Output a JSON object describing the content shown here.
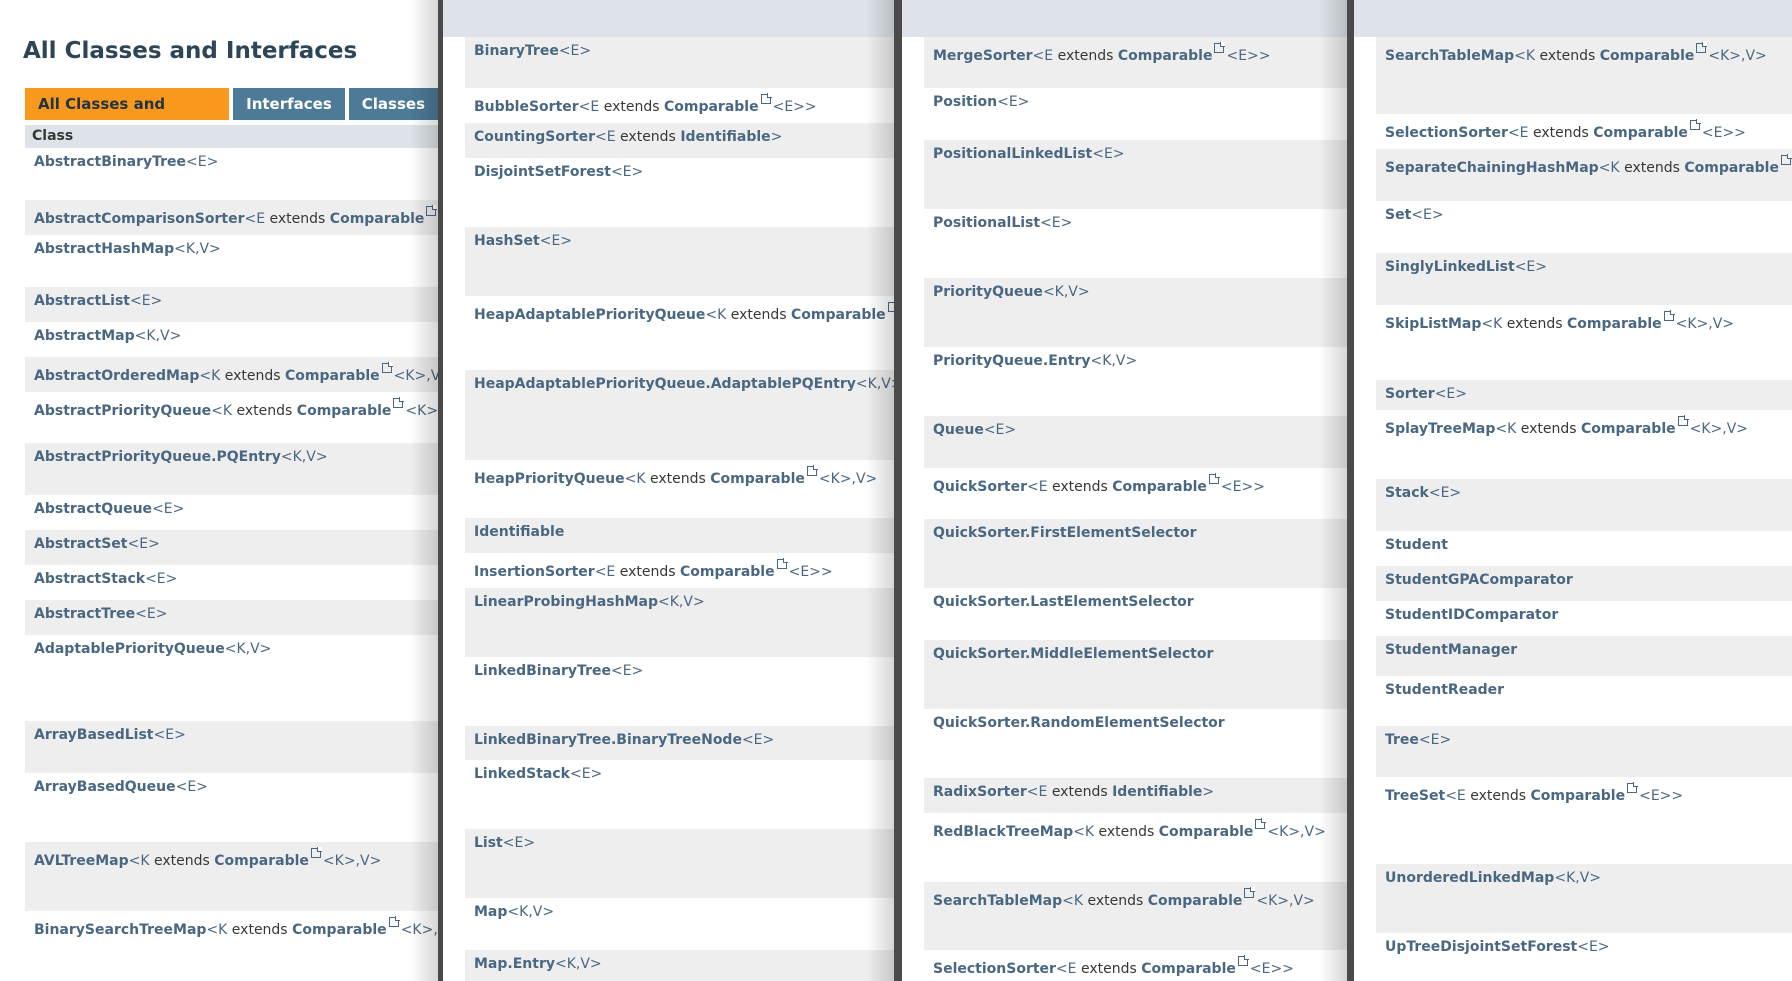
{
  "title": "All Classes and Interfaces",
  "tabs": [
    {
      "label": "All Classes and Interfaces",
      "active": true
    },
    {
      "label": "Interfaces",
      "active": false
    },
    {
      "label": "Classes",
      "active": false
    }
  ],
  "column_header": "Class",
  "columns": [
    [
      {
        "name": "AbstractBinaryTree",
        "params": "<E>"
      },
      {
        "name": "AbstractComparisonSorter",
        "params": "<E extends Comparable<E>>"
      },
      {
        "name": "AbstractHashMap",
        "params": "<K,V>"
      },
      {
        "name": "AbstractList",
        "params": "<E>"
      },
      {
        "name": "AbstractMap",
        "params": "<K,V>"
      },
      {
        "name": "AbstractOrderedMap",
        "params": "<K extends Comparable<K>,V>"
      },
      {
        "name": "AbstractPriorityQueue",
        "params": "<K extends Comparable<K>,V>"
      },
      {
        "name": "AbstractPriorityQueue.PQEntry",
        "params": "<K,V>"
      },
      {
        "name": "AbstractQueue",
        "params": "<E>"
      },
      {
        "name": "AbstractSet",
        "params": "<E>"
      },
      {
        "name": "AbstractStack",
        "params": "<E>"
      },
      {
        "name": "AbstractTree",
        "params": "<E>"
      },
      {
        "name": "AdaptablePriorityQueue",
        "params": "<K,V>"
      },
      {
        "name": "ArrayBasedList",
        "params": "<E>"
      },
      {
        "name": "ArrayBasedQueue",
        "params": "<E>"
      },
      {
        "name": "AVLTreeMap",
        "params": "<K extends Comparable<K>,V>"
      },
      {
        "name": "BinarySearchTreeMap",
        "params": "<K extends Comparable<K>,V>"
      }
    ],
    [
      {
        "name": "BinaryTree",
        "params": "<E>"
      },
      {
        "name": "BubbleSorter",
        "params": "<E extends Comparable<E>>"
      },
      {
        "name": "CountingSorter",
        "params": "<E extends Identifiable>"
      },
      {
        "name": "DisjointSetForest",
        "params": "<E>"
      },
      {
        "name": "HashSet",
        "params": "<E>"
      },
      {
        "name": "HeapAdaptablePriorityQueue",
        "params": "<K extends Comparable<K>,V>"
      },
      {
        "name": "HeapAdaptablePriorityQueue.AdaptablePQEntry",
        "params": "<K,V>"
      },
      {
        "name": "HeapPriorityQueue",
        "params": "<K extends Comparable<K>,V>"
      },
      {
        "name": "Identifiable",
        "params": ""
      },
      {
        "name": "InsertionSorter",
        "params": "<E extends Comparable<E>>"
      },
      {
        "name": "LinearProbingHashMap",
        "params": "<K,V>"
      },
      {
        "name": "LinkedBinaryTree",
        "params": "<E>"
      },
      {
        "name": "LinkedBinaryTree.BinaryTreeNode",
        "params": "<E>"
      },
      {
        "name": "LinkedStack",
        "params": "<E>"
      },
      {
        "name": "List",
        "params": "<E>"
      },
      {
        "name": "Map",
        "params": "<K,V>"
      },
      {
        "name": "Map.Entry",
        "params": "<K,V>"
      }
    ],
    [
      {
        "name": "MergeSorter",
        "params": "<E extends Comparable<E>>"
      },
      {
        "name": "Position",
        "params": "<E>"
      },
      {
        "name": "PositionalLinkedList",
        "params": "<E>"
      },
      {
        "name": "PositionalList",
        "params": "<E>"
      },
      {
        "name": "PriorityQueue",
        "params": "<K,V>"
      },
      {
        "name": "PriorityQueue.Entry",
        "params": "<K,V>"
      },
      {
        "name": "Queue",
        "params": "<E>"
      },
      {
        "name": "QuickSorter",
        "params": "<E extends Comparable<E>>"
      },
      {
        "name": "QuickSorter.FirstElementSelector",
        "params": ""
      },
      {
        "name": "QuickSorter.LastElementSelector",
        "params": ""
      },
      {
        "name": "QuickSorter.MiddleElementSelector",
        "params": ""
      },
      {
        "name": "QuickSorter.RandomElementSelector",
        "params": ""
      },
      {
        "name": "RadixSorter",
        "params": "<E extends Identifiable>"
      },
      {
        "name": "RedBlackTreeMap",
        "params": "<K extends Comparable<K>,V>"
      },
      {
        "name": "SearchTableMap",
        "params": "<K extends Comparable<K>,V>"
      },
      {
        "name": "SelectionSorter",
        "params": "<E extends Comparable<E>>"
      }
    ],
    [
      {
        "name": "SearchTableMap",
        "params": "<K extends Comparable<K>,V>"
      },
      {
        "name": "SelectionSorter",
        "params": "<E extends Comparable<E>>"
      },
      {
        "name": "SeparateChainingHashMap",
        "params": "<K extends Comparable<K>,V>"
      },
      {
        "name": "Set",
        "params": "<E>"
      },
      {
        "name": "SinglyLinkedList",
        "params": "<E>"
      },
      {
        "name": "SkipListMap",
        "params": "<K extends Comparable<K>,V>"
      },
      {
        "name": "Sorter",
        "params": "<E>"
      },
      {
        "name": "SplayTreeMap",
        "params": "<K extends Comparable<K>,V>"
      },
      {
        "name": "Stack",
        "params": "<E>"
      },
      {
        "name": "Student",
        "params": ""
      },
      {
        "name": "StudentGPAComparator",
        "params": ""
      },
      {
        "name": "StudentIDComparator",
        "params": ""
      },
      {
        "name": "StudentManager",
        "params": ""
      },
      {
        "name": "StudentReader",
        "params": ""
      },
      {
        "name": "Tree",
        "params": "<E>"
      },
      {
        "name": "TreeSet",
        "params": "<E extends Comparable<E>>"
      },
      {
        "name": "UnorderedLinkedMap",
        "params": "<K,V>"
      },
      {
        "name": "UpTreeDisjointSetForest",
        "params": "<E>"
      }
    ]
  ]
}
